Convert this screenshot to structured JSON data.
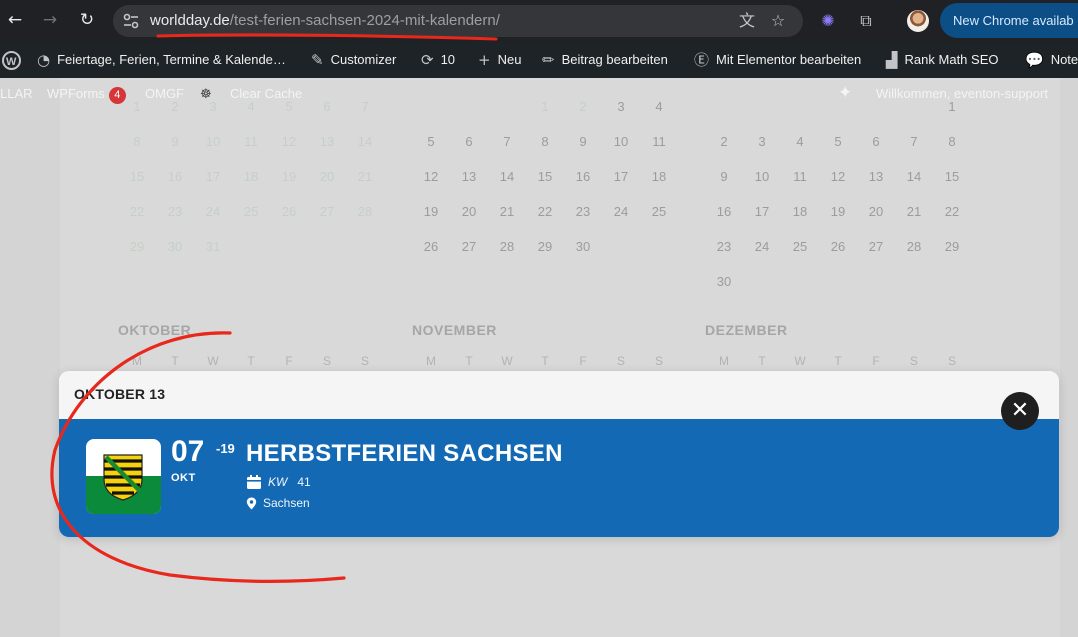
{
  "browser": {
    "url_host": "worldday.de",
    "url_path": "/test-ferien-sachsen-2024-mit-kalendern/",
    "update_chip": "New Chrome availab"
  },
  "wpbar": {
    "site_name": "Feiertage, Ferien, Termine & Kalende…",
    "customizer": "Customizer",
    "updates_count": "10",
    "new": "Neu",
    "edit_post": "Beitrag bearbeiten",
    "elementor": "Mit Elementor bearbeiten",
    "rank_math": "Rank Math SEO",
    "notes": "Note"
  },
  "secondbar": {
    "item1": "LLAR",
    "wpforms": "WPForms",
    "wpforms_badge": "4",
    "omgf": "OMGF",
    "clear_cache": "Clear Cache",
    "welcome": "Willkommen, eventon-support"
  },
  "calendar": {
    "months": [
      "OKTOBER",
      "NOVEMBER",
      "DEZEMBER"
    ],
    "weekdays": [
      "M",
      "T",
      "W",
      "T",
      "F",
      "S",
      "S"
    ]
  },
  "modal": {
    "header_date": "OKTOBER 13",
    "day": "07",
    "day_end": "-19",
    "month_short": "OKT",
    "title": "HERBSTFERIEN SACHSEN",
    "kw_label": "KW",
    "kw_value": "41",
    "location": "Sachsen"
  },
  "colors": {
    "event_bg": "#1469b5",
    "annotation": "#e8281c"
  }
}
